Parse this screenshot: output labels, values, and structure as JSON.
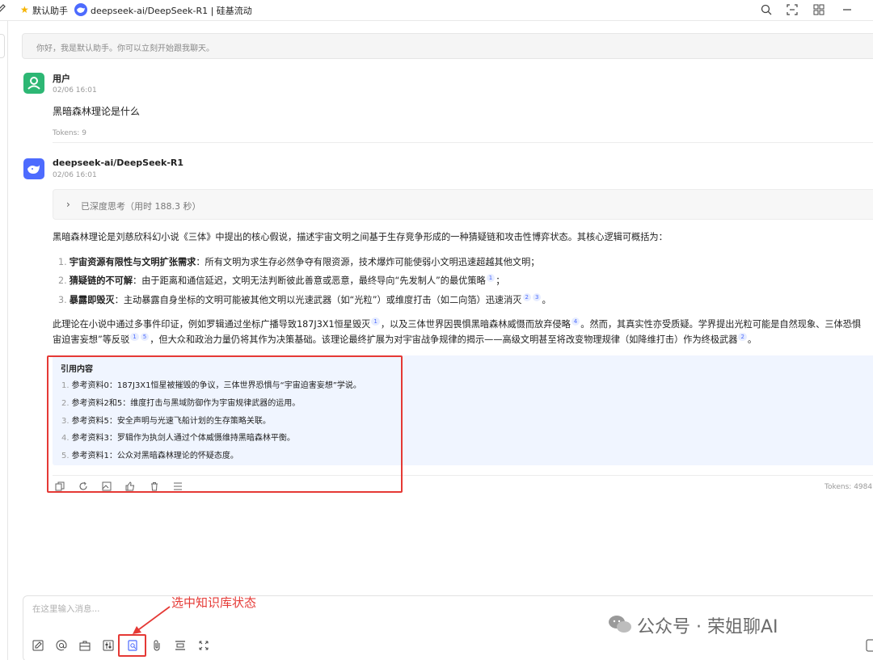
{
  "topbar": {
    "assistant_label": "默认助手",
    "model_title": "deepseek-ai/DeepSeek-R1 | 硅基流动"
  },
  "welcome": "你好，我是默认助手。你可以立刻开始跟我聊天。",
  "user_message": {
    "name": "用户",
    "time": "02/06 16:01",
    "text": "黑暗森林理论是什么",
    "tokens": "Tokens: 9"
  },
  "bot_message": {
    "name": "deepseek-ai/DeepSeek-R1",
    "time": "02/06 16:01",
    "think_label": "已深度思考（用时 188.3 秒）",
    "intro": "黑暗森林理论是刘慈欣科幻小说《三体》中提出的核心假说，描述宇宙文明之间基于生存竞争形成的一种猜疑链和攻击性博弈状态。其核心逻辑可概括为：",
    "points": [
      {
        "n": "1.",
        "bold": "宇宙资源有限性与文明扩张需求",
        "text": "：所有文明为求生存必然争夺有限资源，技术爆炸可能使弱小文明迅速超越其他文明；",
        "refs": []
      },
      {
        "n": "2.",
        "bold": "猜疑链的不可解",
        "text": "：由于距离和通信延迟，文明无法判断彼此善意或恶意，最终导向“先发制人”的最优策略",
        "refs": [
          "1"
        ],
        "tail": "；"
      },
      {
        "n": "3.",
        "bold": "暴露即毁灭",
        "text": "：主动暴露自身坐标的文明可能被其他文明以光速武器（如“光粒”）或维度打击（如二向箔）迅速消灭",
        "refs": [
          "2",
          "3"
        ],
        "tail": "。"
      }
    ],
    "para2_line1_a": "此理论在小说中通过多事件印证，例如罗辑通过坐标广播导致187J3X1恒星毁灭",
    "para2_line1_b": "，以及三体世界因畏惧黑暗森林威慑而放弃侵略",
    "para2_line1_c": "。然而，其真实性亦受质疑。学界提出光粒可能是自然现象、三体恐惧",
    "para2_line2_a": "宙迫害妄想”等反驳",
    "para2_line2_b": "，但大众和政治力量仍将其作为决策基础。该理论最终扩展为对宇宙战争规律的揭示——高级文明甚至将改变物理规律（如降维打击）作为终极武器",
    "para2_line2_c": "。",
    "ref_marks": {
      "r1": "1",
      "r4": "4",
      "r5a": "1",
      "r5b": "5",
      "r2": "2"
    },
    "references_title": "引用内容",
    "references": [
      {
        "n": "1.",
        "text": "参考资料0：187J3X1恒星被摧毁的争议，三体世界恐惧与“宇宙迫害妄想”学说。"
      },
      {
        "n": "2.",
        "text": "参考资料2和5：维度打击与黑域防御作为宇宙规律武器的运用。"
      },
      {
        "n": "3.",
        "text": "参考资料5：安全声明与光速飞船计划的生存策略关联。"
      },
      {
        "n": "4.",
        "text": "参考资料3：罗辑作为执剑人通过个体威慑维持黑暗森林平衡。"
      },
      {
        "n": "5.",
        "text": "参考资料1：公众对黑暗森林理论的怀疑态度。"
      }
    ],
    "tokens": "Tokens: 4984 |"
  },
  "input": {
    "placeholder": "在这里输入消息..."
  },
  "annotation": "选中知识库状态",
  "watermark": "公众号 · 荣姐聊AI",
  "colors": {
    "accent": "#4d6bfe",
    "user_avatar": "#2db774",
    "annotation_red": "#e53935",
    "reference_bg": "#f0f5ff"
  }
}
